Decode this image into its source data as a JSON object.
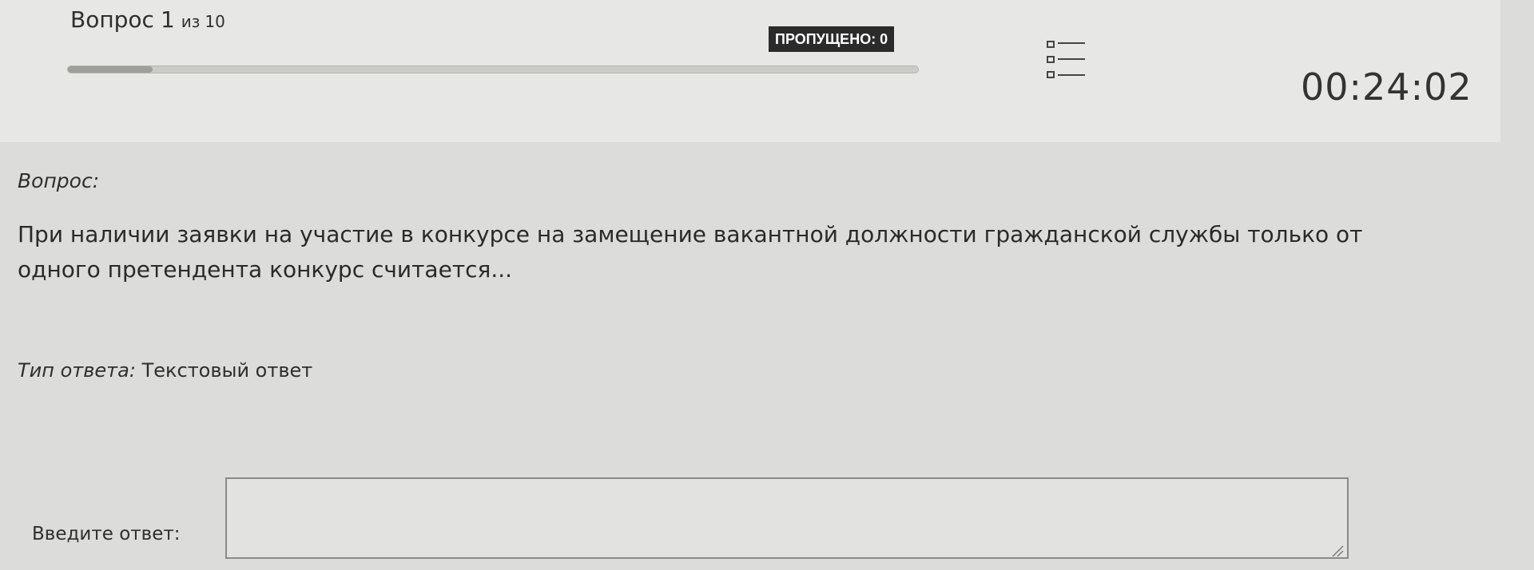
{
  "header": {
    "question_word": "Вопрос",
    "current_number": "1",
    "of_word": "из",
    "total": "10",
    "skipped_badge": "ПРОПУЩЕНО: 0",
    "timer": "00:24:02",
    "progress_fraction": 0.1,
    "question_list_icon": "list-icon"
  },
  "question": {
    "section_label": "Вопрос:",
    "text": "При наличии заявки на участие в конкурсе на замещение вакантной должности гражданской службы только от одного претендента конкурс считается..."
  },
  "answer_type": {
    "label": "Тип ответа:",
    "value": "Текстовый ответ"
  },
  "answer": {
    "label": "Введите ответ:",
    "value": ""
  },
  "colors": {
    "badge_background": "#2b2b2b",
    "badge_text": "#ffffff",
    "page_background": "#dcdcda"
  }
}
